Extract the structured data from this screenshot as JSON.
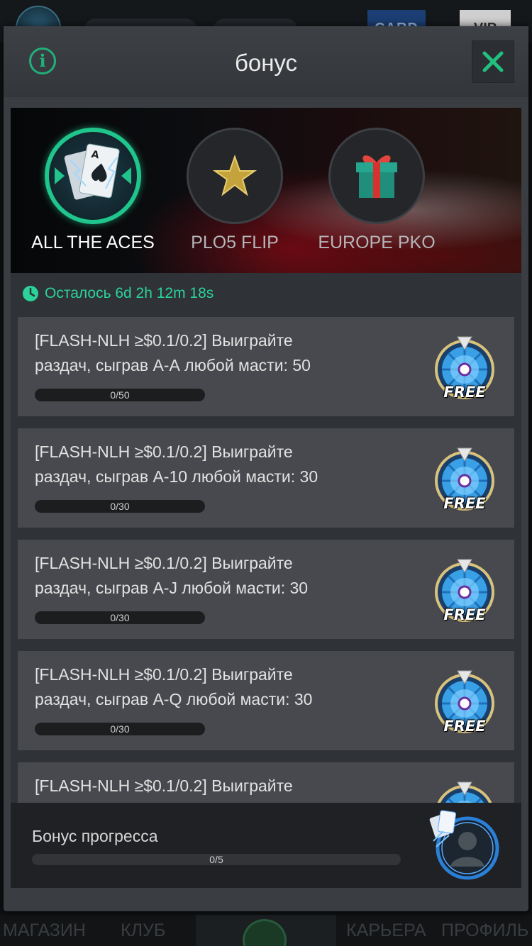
{
  "modal": {
    "title": "бонус",
    "info_icon": "info-icon",
    "close_icon": "close-icon"
  },
  "events": [
    {
      "label": "ALL THE ACES",
      "active": true,
      "icon": "ace-cards-icon"
    },
    {
      "label": "PLO5 FLIP",
      "active": false,
      "icon": "star-icon"
    },
    {
      "label": "EUROPE PKO",
      "active": false,
      "icon": "gift-box-icon"
    }
  ],
  "countdown": {
    "text": "Осталось 6d 2h 12m 18s",
    "icon": "clock-icon"
  },
  "tasks": [
    {
      "line1": "[FLASH-NLH ≥$0.1/0.2] Выиграйте",
      "line2": "раздач, сыграв А-А любой масти: 50",
      "progress_text": "0/50",
      "progress": 0,
      "reward_label": "FREE"
    },
    {
      "line1": "[FLASH-NLH ≥$0.1/0.2] Выиграйте",
      "line2": "раздач, сыграв А-10 любой масти: 30",
      "progress_text": "0/30",
      "progress": 0,
      "reward_label": "FREE"
    },
    {
      "line1": "[FLASH-NLH ≥$0.1/0.2] Выиграйте",
      "line2": "раздач, сыграв A-J любой масти: 30",
      "progress_text": "0/30",
      "progress": 0,
      "reward_label": "FREE"
    },
    {
      "line1": "[FLASH-NLH ≥$0.1/0.2] Выиграйте",
      "line2": "раздач, сыграв А-Q любой масти: 30",
      "progress_text": "0/30",
      "progress": 0,
      "reward_label": "FREE"
    },
    {
      "line1": "[FLASH-NLH ≥$0.1/0.2] Выиграйте",
      "line2": "",
      "progress_text": "",
      "progress": 0,
      "reward_label": ""
    }
  ],
  "bonus_progress": {
    "label": "Бонус прогресса",
    "progress_text": "0/5",
    "progress": 0,
    "reward_icon": "avatar-frame-icon"
  },
  "bottom_nav": {
    "shop": "МАГАЗИН",
    "club": "КЛУБ",
    "career": "КАРЬЕРА",
    "profile": "ПРОФИЛЬ"
  },
  "top_bar": {
    "card_badge": "CARD",
    "vip_badge": "VIP"
  },
  "colors": {
    "accent": "#22b07a",
    "countdown": "#2bd39a",
    "modal_bg": "#3a3d42",
    "task_bg": "#47494e"
  }
}
